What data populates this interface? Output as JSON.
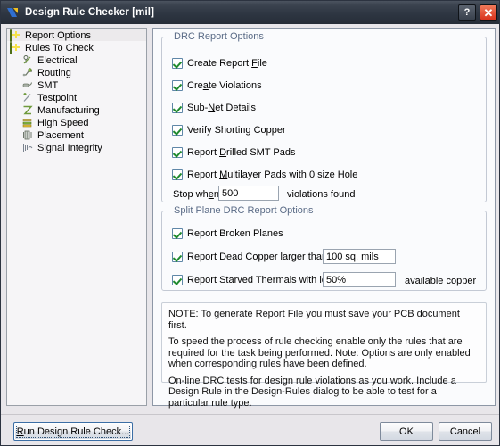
{
  "window": {
    "title": "Design Rule Checker [mil]",
    "app_icon": "altium-logo-icon",
    "help_label": "?",
    "close_label": "✕"
  },
  "tree": {
    "items": [
      {
        "label": "Report Options",
        "icon": "green-folder-icon",
        "level": 0,
        "selected": true
      },
      {
        "label": "Rules To Check",
        "icon": "green-folder-icon",
        "level": 0,
        "selected": false
      },
      {
        "label": "Electrical",
        "icon": "electrical-rule-icon",
        "level": 1,
        "selected": false
      },
      {
        "label": "Routing",
        "icon": "routing-rule-icon",
        "level": 1,
        "selected": false
      },
      {
        "label": "SMT",
        "icon": "smt-rule-icon",
        "level": 1,
        "selected": false
      },
      {
        "label": "Testpoint",
        "icon": "testpoint-rule-icon",
        "level": 1,
        "selected": false
      },
      {
        "label": "Manufacturing",
        "icon": "manufacturing-rule-icon",
        "level": 1,
        "selected": false
      },
      {
        "label": "High Speed",
        "icon": "high-speed-rule-icon",
        "level": 1,
        "selected": false
      },
      {
        "label": "Placement",
        "icon": "placement-rule-icon",
        "level": 1,
        "selected": false
      },
      {
        "label": "Signal Integrity",
        "icon": "signal-integrity-rule-icon",
        "level": 1,
        "selected": false
      }
    ]
  },
  "drc_report_options": {
    "title": "DRC Report Options",
    "checkboxes": [
      {
        "label_before": "Create Report ",
        "accel": "F",
        "label_after": "ile",
        "checked": true
      },
      {
        "label_before": "Cre",
        "accel": "a",
        "label_after": "te Violations",
        "checked": true
      },
      {
        "label_before": "Sub-",
        "accel": "N",
        "label_after": "et Details",
        "checked": true
      },
      {
        "label_before": "Verify Shorting Copper",
        "accel": "",
        "label_after": "",
        "checked": true
      },
      {
        "label_before": "Report ",
        "accel": "D",
        "label_after": "rilled SMT Pads",
        "checked": true
      },
      {
        "label_before": "Report ",
        "accel": "M",
        "label_after": "ultilayer Pads with 0 size Hole",
        "checked": true
      }
    ],
    "stop_when": {
      "label_before": "Stop wh",
      "accel": "e",
      "label_after": "n",
      "value": "500",
      "suffix": "violations found"
    }
  },
  "split_plane_options": {
    "title": "Split Plane DRC Report Options",
    "broken_planes": {
      "label": "Report Broken Planes",
      "checked": true
    },
    "dead_copper": {
      "label": "Report Dead Copper larger than",
      "checked": true,
      "value": "100 sq. mils"
    },
    "starved_thermals": {
      "label": "Report Starved Thermals with less than",
      "checked": true,
      "value": "50%",
      "suffix": "available copper"
    }
  },
  "note": {
    "line1": "NOTE: To generate Report File you must save your PCB document first.",
    "line2": "To speed the process of rule checking enable only the rules that are required for the task being performed.  Note: Options are only enabled when corresponding rules have been defined.",
    "line3": "On-line DRC tests for design rule violations as you work. Include a Design Rule in the Design-Rules dialog to be able to test for a particular rule  type."
  },
  "footer": {
    "run_button": {
      "label_before": "R",
      "accel": "",
      "label_after": "un Design Rule Check...",
      "accel_char": "R"
    },
    "run_label_full": "Run Design Rule Check...",
    "ok_label": "OK",
    "cancel_label": "Cancel"
  },
  "colors": {
    "titlebar_dark": "#2e3642",
    "close_red": "#d9331d",
    "group_title": "#5a6b86",
    "check_green": "#1f8a2e",
    "dialog_bg": "#e8e6ea",
    "panel_bg": "#fafbfd"
  }
}
